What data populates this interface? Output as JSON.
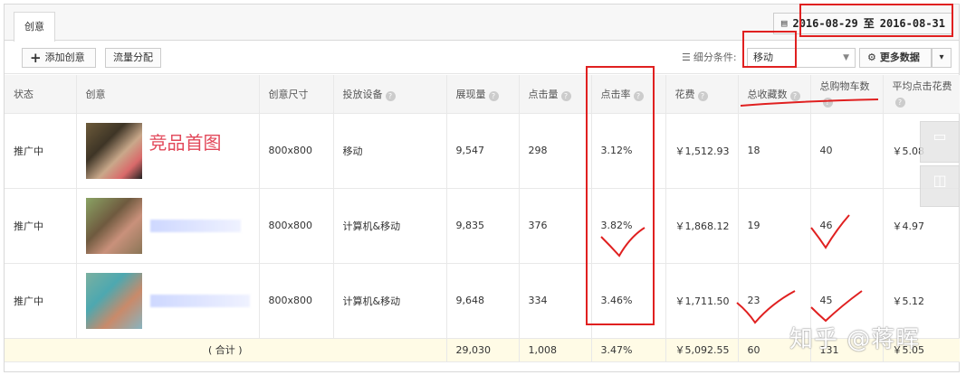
{
  "tab": {
    "label": "创意"
  },
  "date_range": {
    "start": "2016-08-29",
    "sep": "至",
    "end": "2016-08-31"
  },
  "toolbar": {
    "add_label": "添加创意",
    "flow_label": "流量分配",
    "filter_label": "细分条件:",
    "filter_value": "移动",
    "more_label": "更多数据"
  },
  "columns": [
    "状态",
    "创意",
    "创意尺寸",
    "投放设备",
    "展现量",
    "点击量",
    "点击率",
    "花费",
    "总收藏数",
    "总购物车数",
    "平均点击花费"
  ],
  "rows": [
    {
      "status": "推广中",
      "creative_note": "竞品首图",
      "size": "800x800",
      "device": "移动",
      "impressions": "9,547",
      "clicks": "298",
      "ctr": "3.12%",
      "cost": "￥1,512.93",
      "favs": "18",
      "carts": "40",
      "cpc": "￥5.08"
    },
    {
      "status": "推广中",
      "creative_note": "",
      "size": "800x800",
      "device": "计算机&移动",
      "impressions": "9,835",
      "clicks": "376",
      "ctr": "3.82%",
      "cost": "￥1,868.12",
      "favs": "19",
      "carts": "46",
      "cpc": "￥4.97"
    },
    {
      "status": "推广中",
      "creative_note": "",
      "size": "800x800",
      "device": "计算机&移动",
      "impressions": "9,648",
      "clicks": "334",
      "ctr": "3.46%",
      "cost": "￥1,711.50",
      "favs": "23",
      "carts": "45",
      "cpc": "￥5.12"
    }
  ],
  "total": {
    "label": "( 合计 )",
    "impressions": "29,030",
    "clicks": "1,008",
    "ctr": "3.47%",
    "cost": "￥5,092.55",
    "favs": "60",
    "carts": "131",
    "cpc": "￥5.05"
  },
  "watermark": "知乎 @蒋晖",
  "colors": {
    "status_green": "#3a9a1a",
    "annotation_red": "#e02020",
    "total_row_bg": "#fffbe6"
  }
}
